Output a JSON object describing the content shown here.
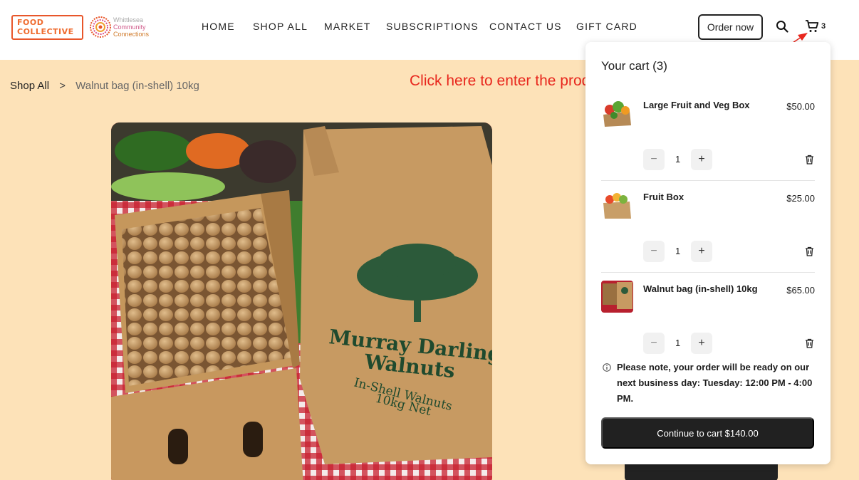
{
  "brand": {
    "logo_primary_line1": "FOOD",
    "logo_primary_line2": "COLLECTIVE",
    "logo_secondary_line1": "Whittlesea",
    "logo_secondary_line2": "Community",
    "logo_secondary_line3": "Connections"
  },
  "nav": {
    "items": [
      "HOME",
      "SHOP ALL",
      "MARKET",
      "SUBSCRIPTIONS",
      "CONTACT US",
      "GIFT CARD"
    ]
  },
  "header": {
    "order_now_label": "Order now",
    "cart_count": "3"
  },
  "breadcrumb": {
    "home": "Shop All",
    "separator": ">",
    "current": "Walnut bag (in-shell) 10kg"
  },
  "annotation": {
    "text": "Click here to enter the product checkout page",
    "color": "#e8271d"
  },
  "product_image": {
    "bag_text_line1": "Murray Darling",
    "bag_text_line2": "Walnuts",
    "bag_text_line3": "In-Shell Walnuts",
    "bag_text_line4": "10kg Net"
  },
  "cart": {
    "title": "Your cart (3)",
    "items": [
      {
        "name": "Large Fruit and Veg Box",
        "price": "$50.00",
        "qty": "1",
        "minus": "−",
        "plus": "+"
      },
      {
        "name": "Fruit Box",
        "price": "$25.00",
        "qty": "1",
        "minus": "−",
        "plus": "+"
      },
      {
        "name": "Walnut bag (in-shell) 10kg",
        "price": "$65.00",
        "qty": "1",
        "minus": "−",
        "plus": "+"
      }
    ],
    "note": "Please note, your order will be ready on our next business day: Tuesday: 12:00 PM - 4:00 PM.",
    "checkout_label": "Continue to cart $140.00"
  },
  "colors": {
    "page_bg": "#fde2b8",
    "brand_orange": "#ef6b2e",
    "button_dark": "#212121"
  }
}
